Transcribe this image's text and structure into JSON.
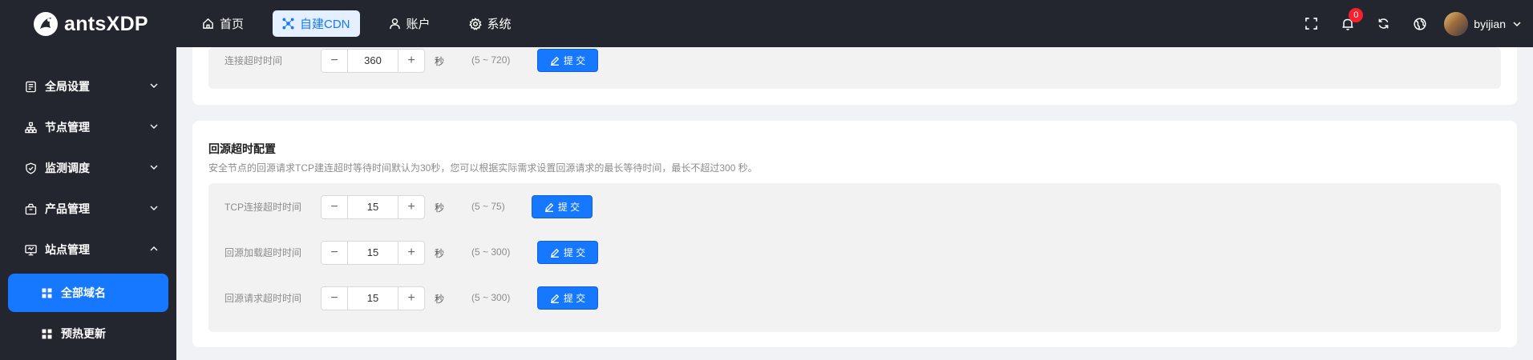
{
  "app": {
    "name": "antsXDP"
  },
  "nav": {
    "items": [
      {
        "label": "首页",
        "icon": "home-icon"
      },
      {
        "label": "自建CDN",
        "icon": "cluster-icon",
        "active": true
      },
      {
        "label": "账户",
        "icon": "user-icon"
      },
      {
        "label": "系统",
        "icon": "gear-icon"
      }
    ]
  },
  "header": {
    "notification_count": "0",
    "username": "byijian"
  },
  "sidebar": {
    "items": [
      {
        "label": "全局设置",
        "icon": "settings-panel-icon",
        "expanded": false
      },
      {
        "label": "节点管理",
        "icon": "cluster-tree-icon",
        "expanded": false
      },
      {
        "label": "监测调度",
        "icon": "shield-icon",
        "expanded": false
      },
      {
        "label": "产品管理",
        "icon": "product-box-icon",
        "expanded": false
      },
      {
        "label": "站点管理",
        "icon": "monitor-icon",
        "expanded": true
      }
    ],
    "subitems": [
      {
        "label": "全部域名",
        "icon": "grid-icon",
        "active": true
      },
      {
        "label": "预热更新",
        "icon": "grid-icon",
        "active": false
      }
    ]
  },
  "connect_section": {
    "rows": [
      {
        "label": "连接超时时间",
        "value": "360",
        "unit": "秒",
        "range": "(5 ~ 720)",
        "submit": "提 交"
      }
    ]
  },
  "origin_section": {
    "title": "回源超时配置",
    "description": "安全节点的回源请求TCP建连超时等待时间默认为30秒，您可以根据实际需求设置回源请求的最长等待时间，最长不超过300 秒。",
    "rows": [
      {
        "label": "TCP连接超时时间",
        "value": "15",
        "unit": "秒",
        "range": "(5 ~ 75)",
        "submit": "提 交"
      },
      {
        "label": "回源加载超时时间",
        "value": "15",
        "unit": "秒",
        "range": "(5 ~ 300)",
        "submit": "提 交"
      },
      {
        "label": "回源请求超时时间",
        "value": "15",
        "unit": "秒",
        "range": "(5 ~ 300)",
        "submit": "提 交"
      }
    ]
  },
  "colors": {
    "accent": "#1677ff",
    "header_bg": "#24262f",
    "badge": "#f5222d"
  }
}
